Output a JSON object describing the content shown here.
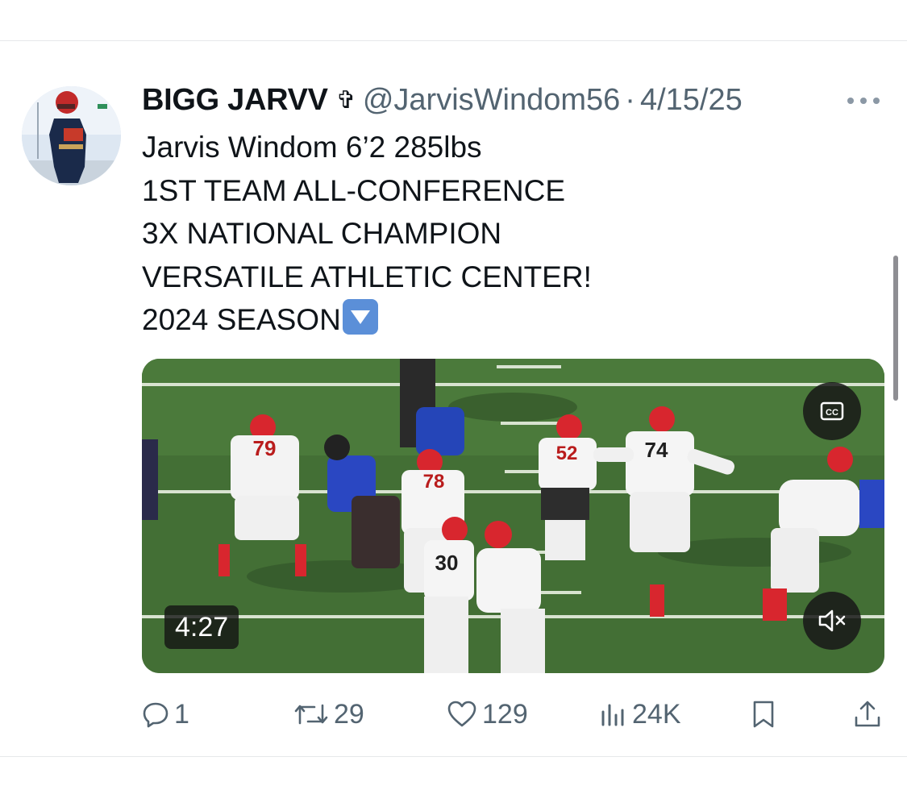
{
  "post": {
    "author_name": "BIGG JARVV",
    "cross_symbol": "✞",
    "handle": "@JarvisWindom56",
    "separator": "·",
    "date": "4/15/25",
    "text_lines": [
      "Jarvis Windom 6’2 285lbs",
      "1ST TEAM ALL-CONFERENCE",
      "3X NATIONAL CHAMPION",
      "VERSATILE ATHLETIC CENTER!",
      "2024 SEASON"
    ]
  },
  "media": {
    "duration": "4:27",
    "jersey_numbers": [
      "79",
      "78",
      "52",
      "74",
      "30"
    ],
    "cc_label": "CC"
  },
  "actions": {
    "replies": "1",
    "reposts": "29",
    "likes": "129",
    "views": "24K"
  },
  "icons": {
    "more": "more-horizontal-icon",
    "reply": "reply-bubble-icon",
    "repost": "repost-icon",
    "like": "heart-icon",
    "views": "views-bar-icon",
    "bookmark": "bookmark-icon",
    "share": "share-icon",
    "cc": "closed-captions-icon",
    "mute": "speaker-muted-icon",
    "emoji": "down-arrow-emoji"
  },
  "colors": {
    "text": "#0f1419",
    "secondary": "#536471",
    "divider": "#e6e8ea",
    "field_green": "#3f6b33",
    "jersey_red": "#d8262e"
  }
}
